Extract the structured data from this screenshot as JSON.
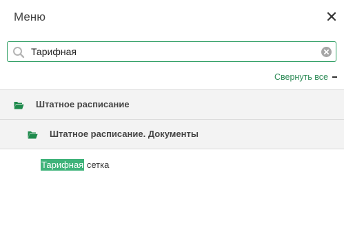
{
  "header": {
    "title": "Меню",
    "close_icon": "close-icon"
  },
  "search": {
    "value": "Тарифная",
    "placeholder": "",
    "search_icon": "search-icon",
    "clear_icon": "clear-circle-icon"
  },
  "collapse": {
    "label": "Свернуть все",
    "icon": "minus-icon"
  },
  "tree": {
    "items": [
      {
        "label": "Штатное расписание",
        "icon": "folder-open-icon"
      },
      {
        "label": "Штатное расписание. Документы",
        "icon": "folder-open-icon"
      }
    ],
    "leaf": {
      "highlight": "Тарифная",
      "rest": " сетка"
    }
  },
  "colors": {
    "accent": "#2e9e63",
    "highlight_bg": "#3fb37a",
    "folder": "#1e8a4c",
    "row_bg": "#f3f3f3"
  }
}
